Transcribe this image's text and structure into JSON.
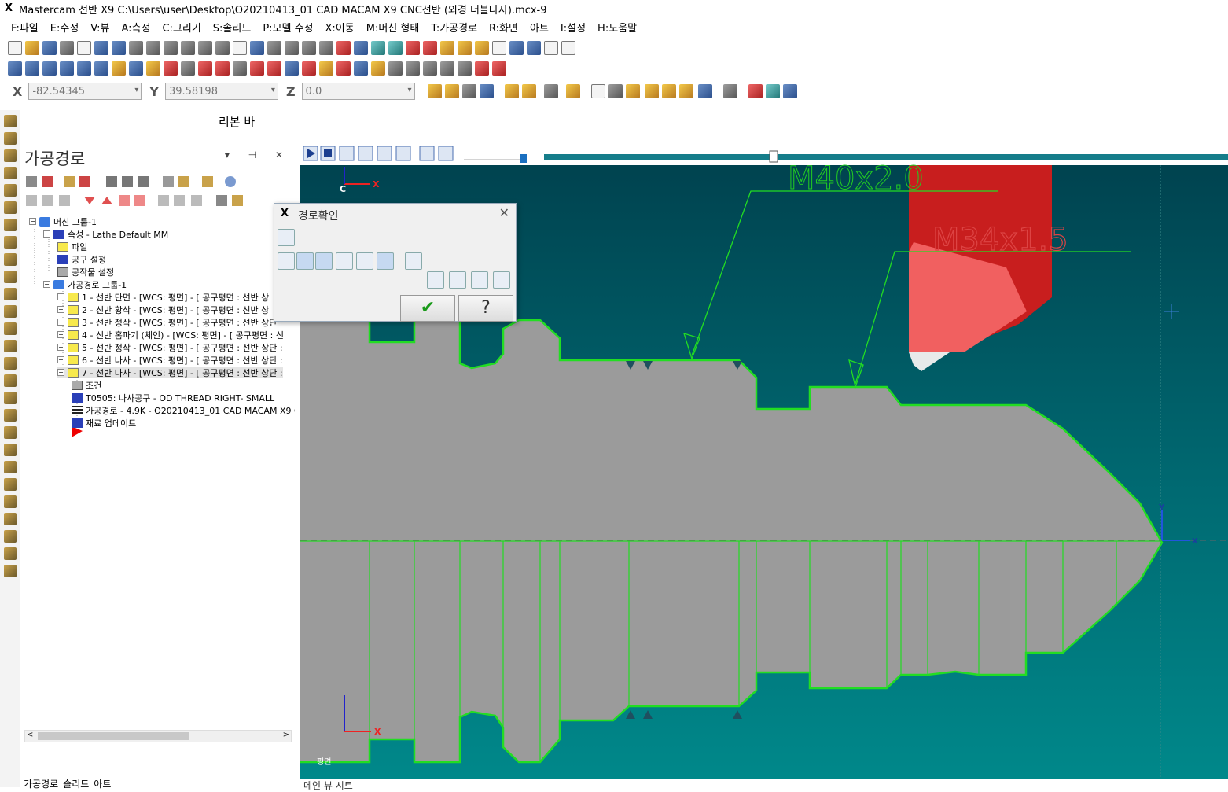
{
  "window": {
    "title": "Mastercam 선반 X9  C:\\Users\\user\\Desktop\\O20210413_01 CAD MACAM X9 CNC선반 (외경 더블나사).mcx-9"
  },
  "menu": [
    "F:파일",
    "E:수정",
    "V:뷰",
    "A:측정",
    "C:그리기",
    "S:솔리드",
    "P:모델 수정",
    "X:이동",
    "M:머신 형태",
    "T:가공경로",
    "R:화면",
    "아트",
    "I:설정",
    "H:도움말"
  ],
  "coords": {
    "x_label": "X",
    "x_value": "-82.54345",
    "y_label": "Y",
    "y_value": "39.58198",
    "z_label": "Z",
    "z_value": "0.0"
  },
  "ribbon_label": "리본 바",
  "panel": {
    "title": "가공경로",
    "tree": [
      {
        "text": "머신 그룹-1",
        "icon": "grp"
      },
      {
        "text": "속성 - Lathe Default MM",
        "icon": "blue"
      },
      {
        "text": "파일",
        "icon": "folder"
      },
      {
        "text": "공구 설정",
        "icon": "blue"
      },
      {
        "text": "공작물 설정",
        "icon": "gray"
      },
      {
        "text": "가공경로 그룹-1",
        "icon": "grp"
      },
      {
        "text": "1 - 선반 단면 - [WCS: 평면] - [  공구평면 : 선반 상",
        "icon": "folder"
      },
      {
        "text": "2 - 선반 황삭 - [WCS: 평면] - [  공구평면 : 선반 상",
        "icon": "folder"
      },
      {
        "text": "3 - 선반 정삭 - [WCS: 평면] - [  공구평면 : 선반 상단",
        "icon": "folder"
      },
      {
        "text": "4 - 선반 홈파기 (체인) - [WCS: 평면] - [  공구평면 : 선",
        "icon": "folder"
      },
      {
        "text": "5 - 선반 정삭 - [WCS: 평면] - [  공구평면 : 선반 상단 :",
        "icon": "folder"
      },
      {
        "text": "6 - 선반 나사 - [WCS: 평면] - [  공구평면 : 선반 상단 :",
        "icon": "folder"
      },
      {
        "text": "7 - 선반 나사 - [WCS: 평면] - [  공구평면 : 선반 상단 :",
        "icon": "folder"
      },
      {
        "text": "조건",
        "icon": "gray"
      },
      {
        "text": "T0505: 나사공구 - OD THREAD RIGHT- SMALL",
        "icon": "blue"
      },
      {
        "text": "가공경로 - 4.9K - O20210413_01 CAD MACAM X9 C",
        "icon": "wave"
      },
      {
        "text": "재료 업데이트",
        "icon": "blue"
      }
    ]
  },
  "bottom_tabs": [
    "가공경로",
    "솔리드",
    "아트"
  ],
  "view_tab": "메인 뷰 시트",
  "dialog": {
    "title": "경로확인",
    "ok": "✔",
    "help": "?"
  },
  "viewport": {
    "label_c": "C",
    "label_x": "X",
    "label_y": "Y",
    "plane_label": "평면",
    "thread_label_1": "M40x2.0",
    "thread_label_2": "M34x1.5"
  }
}
